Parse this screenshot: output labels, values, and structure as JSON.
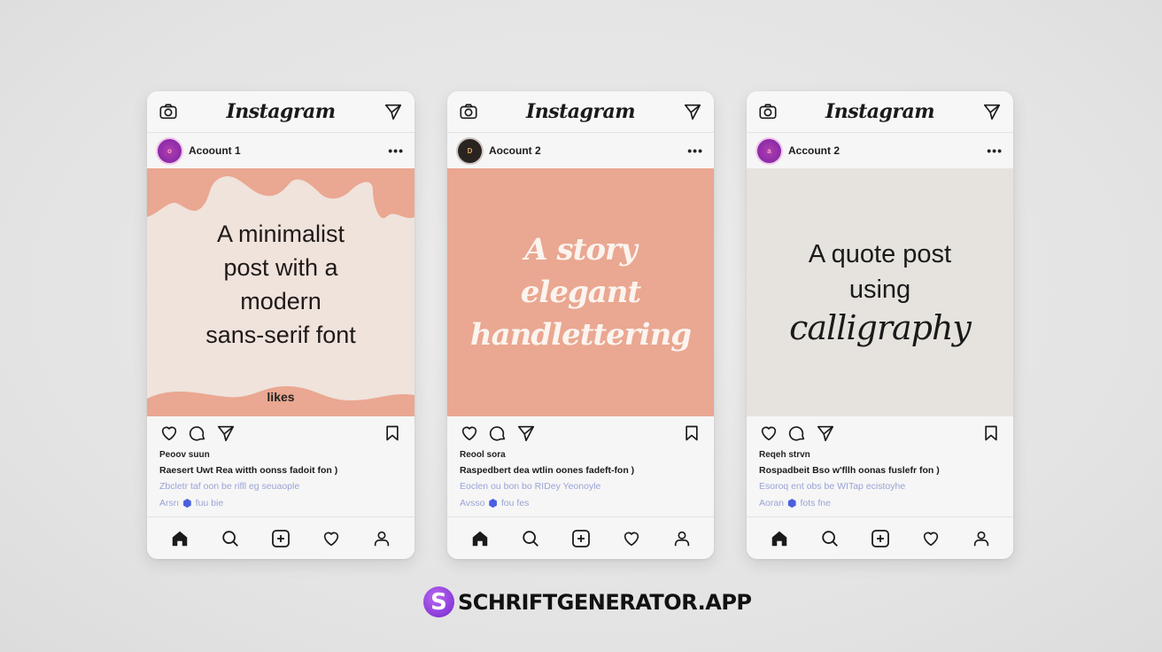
{
  "app": {
    "name": "Instagram"
  },
  "phones": [
    {
      "account_name": "Acoount 1",
      "avatar_letter": "o",
      "post_text_lines": [
        "A minimalist",
        "post with a",
        "modern",
        "sans-serif font"
      ],
      "post_overlay_label": "likes",
      "caption": {
        "line1": "Peoov suun",
        "line2": "Raesert Uwt Rea witth oonss fadoit fon )",
        "line3": "Zbcletr taf oon be rifll eg seuaople",
        "line4_prefix": "Arsrı",
        "line4_suffix": "fuu bie"
      }
    },
    {
      "account_name": "Aocount 2",
      "avatar_letter": "D",
      "post_text_lines": [
        "A story",
        "elegant",
        "handlettering"
      ],
      "caption": {
        "line1": "Reool sora",
        "line2": "Raspedbert dea wtlin oones fadeft-fon )",
        "line3": "Eoclen ou bon bo RIDey Yeonoyle",
        "line4_prefix": "Avsso",
        "line4_suffix": "fou fes"
      }
    },
    {
      "account_name": "Account 2",
      "avatar_letter": "a",
      "post_text_lines": [
        "A quote post",
        "using"
      ],
      "post_script_line": "calligraphy",
      "caption": {
        "line1": "Reqeh strvn",
        "line2": "Rospadbeit Bso w'fllh oonas fuslefr fon )",
        "line3": "Esoroq ent obs be WITap ecistoyhe",
        "line4_prefix": "Aoran",
        "line4_suffix": "fots fne"
      }
    }
  ],
  "icons": {
    "top_left": "camera-icon",
    "top_right": "direct-message-icon",
    "more": "•••",
    "badge": "⬢"
  },
  "brand": {
    "logo_letter": "S",
    "text": "SCHRIFTGENERATOR.APP"
  },
  "colors": {
    "peach": "#eaa791",
    "cream": "#efe3dc",
    "grey_post": "#e6e3de",
    "caption_link": "#9aa3d6",
    "brand_purple": "#8a3ad8"
  }
}
